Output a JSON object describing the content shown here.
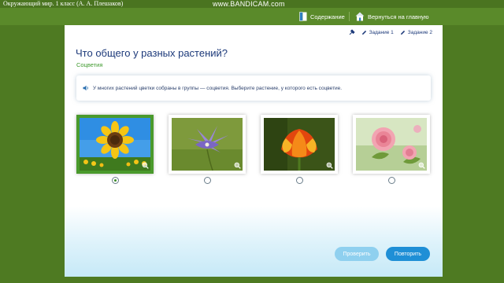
{
  "window": {
    "title": "Окружающий мир. 1 класс (А. А. Плешаков)"
  },
  "watermark": "www.BANDICAM.com",
  "nav": {
    "contents_label": "Содержание",
    "home_label": "Вернуться на главную"
  },
  "tasks": [
    {
      "label": "Задание 1"
    },
    {
      "label": "Задание 2"
    }
  ],
  "heading": "Что общего у разных растений?",
  "subheading": "Соцветия",
  "instruction": "У многих растений цветки собраны в группы — соцветия. Выберите растение, у которого есть соцветие.",
  "options": [
    {
      "picture": "sunflower",
      "selected": true
    },
    {
      "picture": "bellflower",
      "selected": false
    },
    {
      "picture": "tulip",
      "selected": false
    },
    {
      "picture": "rose",
      "selected": false
    }
  ],
  "buttons": {
    "check_label": "Проверить",
    "retry_label": "Повторить"
  },
  "colors": {
    "frame_green": "#4e7a22",
    "heading_blue": "#1d3a7a",
    "subheading_green": "#3f9a2e",
    "selected_border": "#4a9a2c",
    "check_button": "#8fd0ef",
    "retry_button": "#1f8fd6"
  }
}
